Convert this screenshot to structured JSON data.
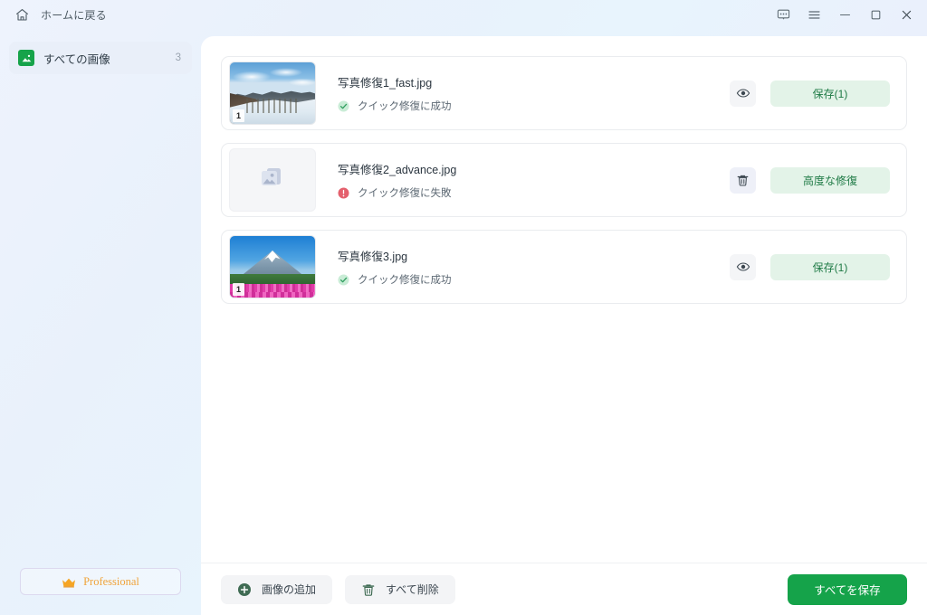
{
  "titlebar": {
    "home_label": "ホームに戻る",
    "home_icon": "home-icon",
    "controls": [
      {
        "name": "feedback-icon",
        "label": ""
      },
      {
        "name": "menu-icon",
        "label": ""
      },
      {
        "name": "minimize-icon",
        "label": ""
      },
      {
        "name": "maximize-icon",
        "label": ""
      },
      {
        "name": "close-icon",
        "label": ""
      }
    ]
  },
  "sidebar": {
    "items": [
      {
        "label": "すべての画像",
        "count": "3",
        "icon": "image-icon",
        "active": true
      }
    ],
    "pro": {
      "label": "Professional",
      "icon": "crown-icon",
      "color": "#f0a33a"
    }
  },
  "main": {
    "rows": [
      {
        "filename": "写真修復1_fast.jpg",
        "status_text": "クイック修復に成功",
        "status_type": "success",
        "thumb_type": "winter-mountain",
        "thumb_badge": "1",
        "icon_button": "preview-eye-icon",
        "action_label": "保存(1)"
      },
      {
        "filename": "写真修復2_advance.jpg",
        "status_text": "クイック修復に失敗",
        "status_type": "error",
        "thumb_type": "placeholder",
        "thumb_badge": "",
        "icon_button": "delete-trash-icon",
        "action_label": "高度な修復"
      },
      {
        "filename": "写真修復3.jpg",
        "status_text": "クイック修復に成功",
        "status_type": "success",
        "thumb_type": "fuji",
        "thumb_badge": "1",
        "icon_button": "preview-eye-icon",
        "action_label": "保存(1)"
      }
    ]
  },
  "bottombar": {
    "add_images_label": "画像の追加",
    "add_images_icon": "plus-circle-icon",
    "delete_all_label": "すべて削除",
    "delete_all_icon": "trash-icon",
    "save_all_label": "すべてを保存"
  },
  "colors": {
    "accent_green": "#15a34a",
    "pill_bg": "#e3f3e8",
    "pill_text": "#1e7a45",
    "pro_orange": "#f0a33a",
    "error_red": "#e4606d"
  }
}
